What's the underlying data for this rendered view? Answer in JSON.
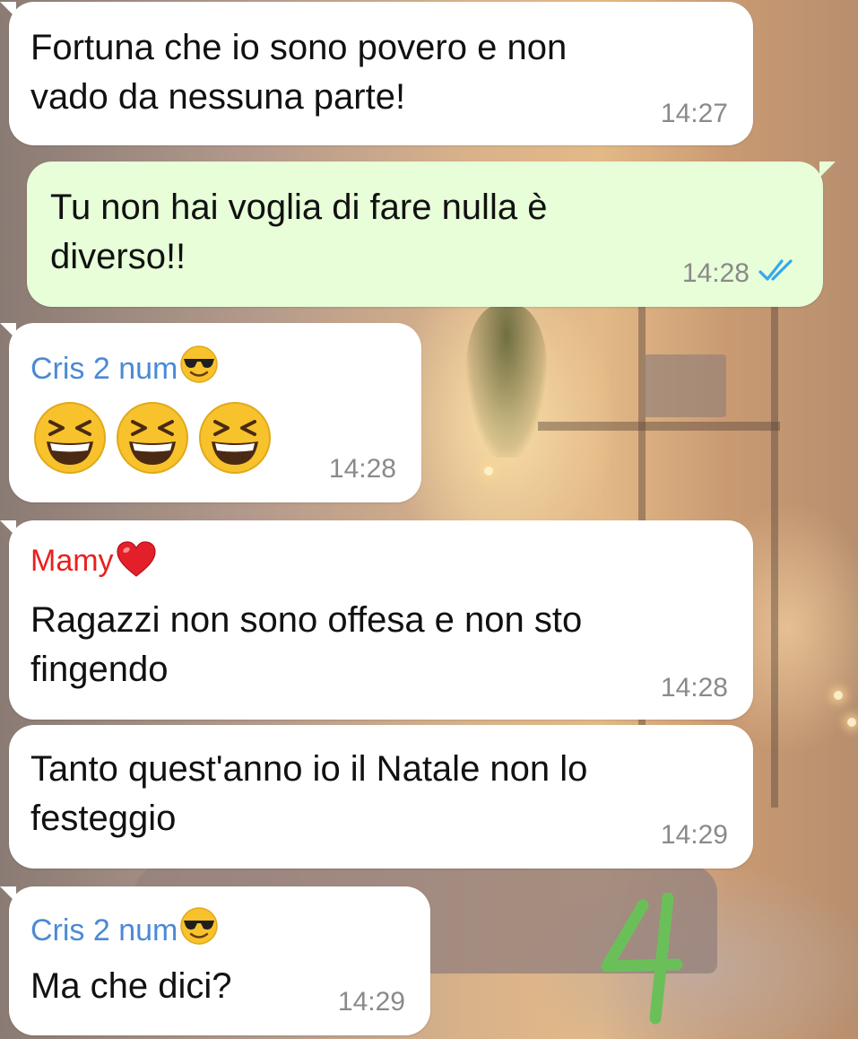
{
  "colors": {
    "incoming_bubble": "#ffffff",
    "outgoing_bubble": "#e7fed8",
    "sender_cris": "#4b8ad4",
    "sender_mamy": "#e8211f",
    "timestamp": "#8a8a8a",
    "read_ticks": "#35a7ee",
    "annotation_mark": "#6bbf59"
  },
  "messages": [
    {
      "direction": "incoming",
      "lines": [
        "Fortuna che io sono povero e non",
        "vado da nessuna parte!"
      ],
      "time": "14:27"
    },
    {
      "direction": "outgoing",
      "lines": [
        "Tu non hai voglia di fare nulla è",
        "diverso!!"
      ],
      "time": "14:28",
      "status_icon": "double-check-read-icon"
    },
    {
      "direction": "incoming",
      "sender": "Cris 2 num",
      "sender_emoji": "smiling-face-with-sunglasses-icon",
      "emojis": [
        "grinning-squinting-face-icon",
        "grinning-squinting-face-icon",
        "grinning-squinting-face-icon"
      ],
      "time": "14:28"
    },
    {
      "direction": "incoming",
      "sender": "Mamy",
      "sender_emoji": "red-heart-icon",
      "lines": [
        "Ragazzi non sono offesa e non sto",
        "fingendo"
      ],
      "time": "14:28"
    },
    {
      "direction": "incoming",
      "lines": [
        "Tanto quest'anno io il Natale non lo",
        "festeggio"
      ],
      "time": "14:29"
    },
    {
      "direction": "incoming",
      "sender": "Cris 2 num",
      "sender_emoji": "smiling-face-with-sunglasses-icon",
      "lines": [
        "Ma che dici?"
      ],
      "time": "14:29"
    }
  ],
  "annotation": {
    "text": "4"
  }
}
